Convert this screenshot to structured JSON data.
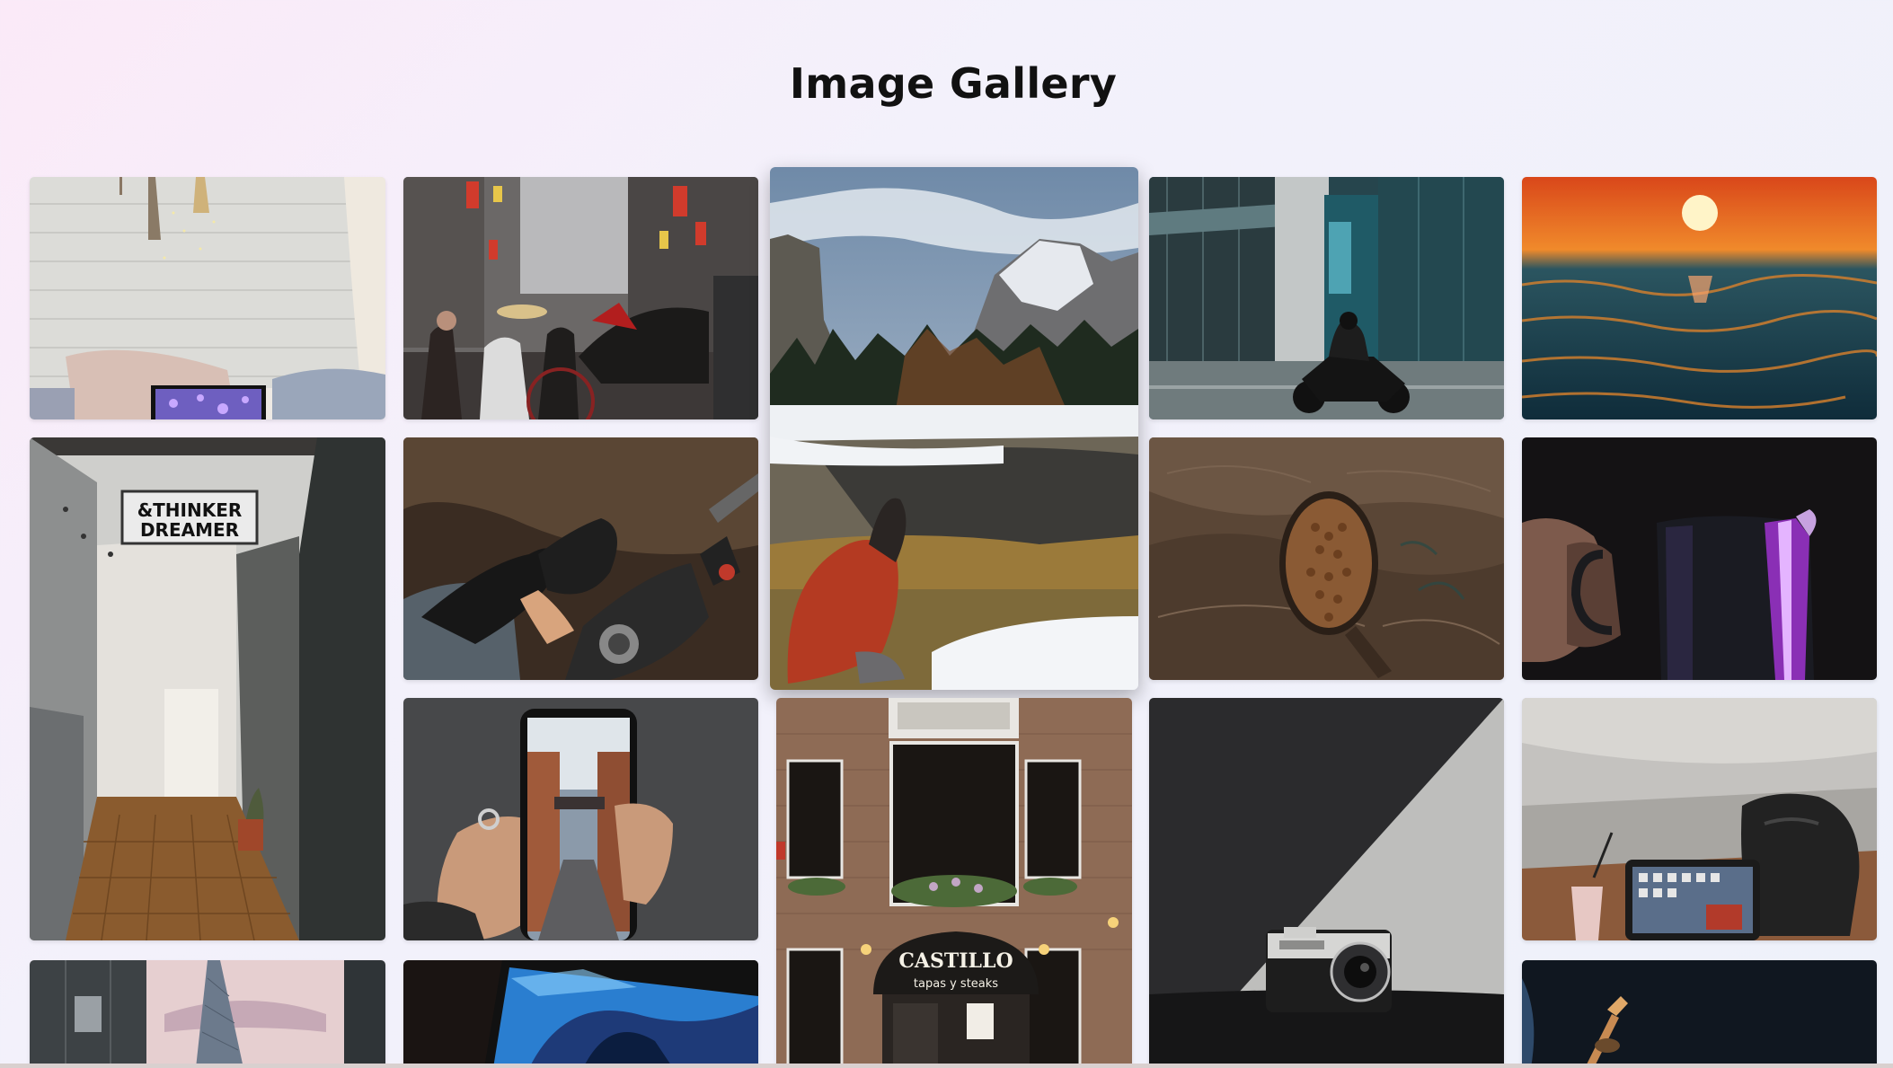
{
  "page": {
    "title": "Image Gallery"
  },
  "photos": [
    {
      "id": "bedroom-laptop",
      "alt": "Laptop on bed"
    },
    {
      "id": "street-rickshaw",
      "alt": "Street with rickshaw"
    },
    {
      "id": "yosemite-photographer",
      "alt": "Photographer at Yosemite"
    },
    {
      "id": "motorcycle-city",
      "alt": "Motorcycle in city"
    },
    {
      "id": "sunset-sea",
      "alt": "Sunset over the sea"
    },
    {
      "id": "thinker-dreamer-hallway",
      "alt": "Hallway with sign"
    },
    {
      "id": "motorcycle-gloves",
      "alt": "Hands in gloves on motorcycle"
    },
    {
      "id": "coffee-beans-sack",
      "alt": "Coffee beans on sack"
    },
    {
      "id": "iridescent-mug",
      "alt": "Hand holding mug"
    },
    {
      "id": "phone-street-photo",
      "alt": "Phone showing street photo"
    },
    {
      "id": "castillo-building",
      "alt": "Brick building facade"
    },
    {
      "id": "vintage-camera",
      "alt": "Vintage camera"
    },
    {
      "id": "tablet-backpack",
      "alt": "Tablet and backpack"
    },
    {
      "id": "tower-skyline",
      "alt": "Tower between buildings"
    },
    {
      "id": "tablet-abstract",
      "alt": "Tablet with blue wallpaper"
    },
    {
      "id": "dark-instrument",
      "alt": "Dark photo"
    }
  ],
  "signs": {
    "hallway_sign_line1": "&THINKER",
    "hallway_sign_line2": "DREAMER",
    "restaurant_name": "CASTILLO",
    "restaurant_tagline": "tapas y steaks"
  },
  "colors": {
    "background_start": "#fbeaf8",
    "background_end": "#eef1fa",
    "title": "#111111"
  }
}
